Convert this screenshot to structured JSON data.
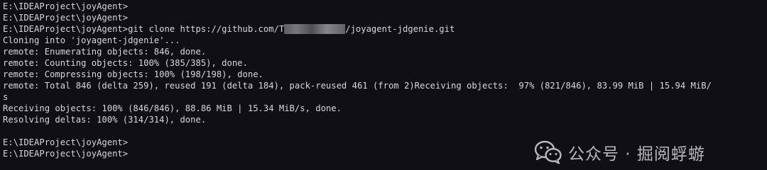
{
  "terminal": {
    "lines": [
      "E:\\IDEAProject\\joyAgent>",
      "E:\\IDEAProject\\joyAgent>",
      {
        "before": "E:\\IDEAProject\\joyAgent>git clone https://github.com/T",
        "after": "/joyagent-jdgenie.git"
      },
      "Cloning into 'joyagent-jdgenie'...",
      "remote: Enumerating objects: 846, done.",
      "remote: Counting objects: 100% (385/385), done.",
      "remote: Compressing objects: 100% (198/198), done.",
      "remote: Total 846 (delta 259), reused 191 (delta 184), pack-reused 461 (from 2)Receiving objects:  97% (821/846), 83.99 MiB | 15.94 MiB/",
      "s",
      "Receiving objects: 100% (846/846), 88.86 MiB | 15.34 MiB/s, done.",
      "Resolving deltas: 100% (314/314), done.",
      "",
      "E:\\IDEAProject\\joyAgent>",
      "E:\\IDEAProject\\joyAgent>"
    ]
  },
  "watermark": {
    "text": "公众号 · 掘阅蜉蝣",
    "icon": "wechat-icon"
  },
  "colors": {
    "background": "#101014",
    "text": "#d8d8d8",
    "watermark": "#b9b9be"
  }
}
